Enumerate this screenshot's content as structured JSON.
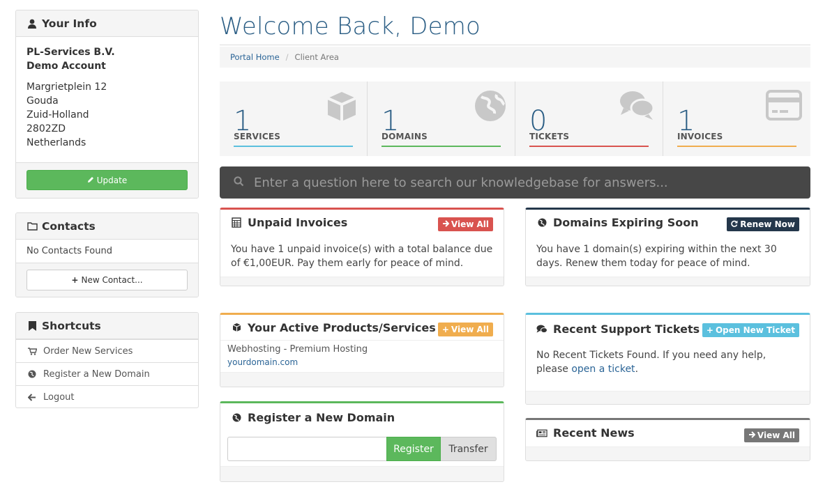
{
  "sidebar": {
    "your_info": {
      "title": "Your Info",
      "company": "PL-Services B.V.",
      "account": "Demo Account",
      "address": [
        "Margrietplein 12",
        "Gouda",
        "Zuid-Holland",
        "2802ZD",
        "Netherlands"
      ],
      "update_label": "Update"
    },
    "contacts": {
      "title": "Contacts",
      "empty_text": "No Contacts Found",
      "new_label": "New Contact..."
    },
    "shortcuts": {
      "title": "Shortcuts",
      "items": [
        {
          "label": "Order New Services",
          "icon": "cart-icon"
        },
        {
          "label": "Register a New Domain",
          "icon": "globe-icon"
        },
        {
          "label": "Logout",
          "icon": "arrow-left-icon"
        }
      ]
    }
  },
  "header": {
    "title": "Welcome Back, Demo",
    "breadcrumb": [
      "Portal Home",
      "Client Area"
    ]
  },
  "stats": [
    {
      "value": "1",
      "label": "SERVICES",
      "color": "#5bc0de",
      "icon": "cube-icon"
    },
    {
      "value": "1",
      "label": "DOMAINS",
      "color": "#5cb85c",
      "icon": "globe-icon"
    },
    {
      "value": "0",
      "label": "TICKETS",
      "color": "#d9534f",
      "icon": "comments-icon"
    },
    {
      "value": "1",
      "label": "INVOICES",
      "color": "#f0ad4e",
      "icon": "credit-card-icon"
    }
  ],
  "search": {
    "placeholder": "Enter a question here to search our knowledgebase for answers..."
  },
  "panels": {
    "unpaid": {
      "title": "Unpaid Invoices",
      "button": "View All",
      "text": "You have 1 unpaid invoice(s) with a total balance due of €1,00EUR. Pay them early for peace of mind.",
      "color": "#d9534f"
    },
    "expiring": {
      "title": "Domains Expiring Soon",
      "button": "Renew Now",
      "text": "You have 1 domain(s) expiring within the next 30 days. Renew them today for peace of mind.",
      "color": "#24374b"
    },
    "products": {
      "title": "Your Active Products/Services",
      "button": "View All",
      "product_name": "Webhosting - Premium Hosting",
      "product_domain": "yourdomain.com",
      "color": "#f0ad4e"
    },
    "tickets": {
      "title": "Recent Support Tickets",
      "button": "Open New Ticket",
      "text": "No Recent Tickets Found. If you need any help, please",
      "link": "open a ticket",
      "after_link": ".",
      "color": "#5bc0de"
    },
    "register": {
      "title": "Register a New Domain",
      "register_label": "Register",
      "transfer_label": "Transfer",
      "color": "#5cb85c"
    },
    "news": {
      "title": "Recent News",
      "button": "View All",
      "color": "#777777"
    }
  }
}
